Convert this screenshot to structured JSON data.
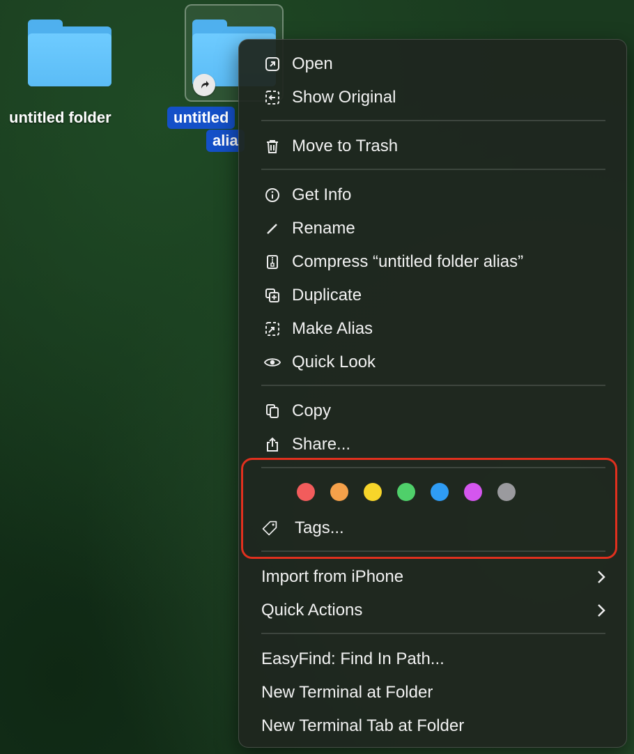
{
  "desktop": {
    "folder1": {
      "label": "untitled folder"
    },
    "folder2": {
      "label_line1": "untitled",
      "label_line2": "alia"
    }
  },
  "menu": {
    "open": "Open",
    "show_original": "Show Original",
    "move_to_trash": "Move to Trash",
    "get_info": "Get Info",
    "rename": "Rename",
    "compress": "Compress “untitled folder alias”",
    "duplicate": "Duplicate",
    "make_alias": "Make Alias",
    "quick_look": "Quick Look",
    "copy": "Copy",
    "share": "Share...",
    "tags": "Tags...",
    "import_from_iphone": "Import from iPhone",
    "quick_actions": "Quick Actions",
    "easyfind": "EasyFind: Find In Path...",
    "new_terminal": "New Terminal at Folder",
    "new_terminal_tab": "New Terminal Tab at Folder"
  },
  "tag_colors": {
    "red": "#f25c5c",
    "orange": "#f5a14a",
    "yellow": "#f7d52a",
    "green": "#4fd06a",
    "blue": "#2f9cf4",
    "purple": "#d456ee",
    "gray": "#9a9a9e"
  },
  "highlight_color": "#e0301e"
}
